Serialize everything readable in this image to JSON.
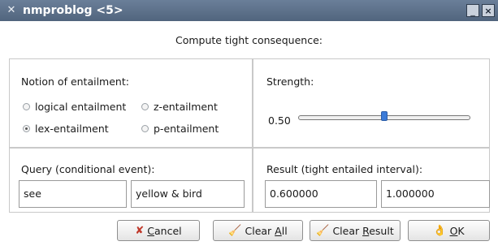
{
  "window": {
    "title": "nmproblog <5>",
    "app_icon": "x-logo-icon",
    "minimize_label": "_",
    "close_label": "×"
  },
  "heading": "Compute tight consequence:",
  "entailment": {
    "label": "Notion of entailment:",
    "options": [
      {
        "label": "logical entailment",
        "selected": false
      },
      {
        "label": "z-entailment",
        "selected": false
      },
      {
        "label": "lex-entailment",
        "selected": true
      },
      {
        "label": "p-entailment",
        "selected": false
      }
    ]
  },
  "strength": {
    "label": "Strength:",
    "value_text": "0.50",
    "value": 0.5,
    "min": 0,
    "max": 1
  },
  "query": {
    "label": "Query (conditional event):",
    "consequent": "see",
    "antecedent": "yellow & bird"
  },
  "result": {
    "label": "Result (tight entailed interval):",
    "lower": "0.600000",
    "upper": "1.000000"
  },
  "buttons": {
    "cancel": {
      "pre": "",
      "mnemonic": "C",
      "post": "ancel",
      "icon": "cancel-x-icon"
    },
    "clear_all": {
      "pre": "Clear ",
      "mnemonic": "A",
      "post": "ll",
      "icon": "broom-icon"
    },
    "clear_result": {
      "pre": "Clear ",
      "mnemonic": "R",
      "post": "esult",
      "icon": "broom-icon"
    },
    "ok": {
      "pre": "",
      "mnemonic": "O",
      "post": "K",
      "icon": "ok-hand-icon"
    }
  }
}
